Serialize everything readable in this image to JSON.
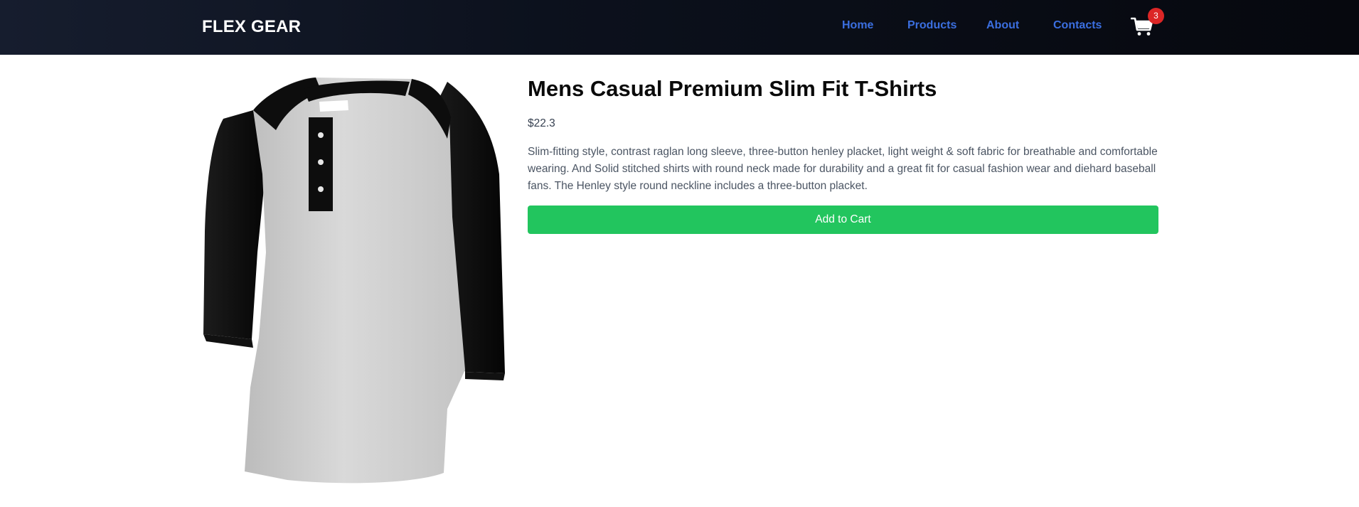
{
  "navbar": {
    "brand": "FLEX GEAR",
    "links": [
      {
        "label": "Home"
      },
      {
        "label": "Products"
      },
      {
        "label": "About"
      },
      {
        "label": "Contacts"
      }
    ],
    "cart": {
      "icon": "cart-icon",
      "count": "3"
    }
  },
  "product": {
    "title": "Mens Casual Premium Slim Fit T-Shirts",
    "price": "$22.3",
    "description": "Slim-fitting style, contrast raglan long sleeve, three-button henley placket, light weight & soft fabric for breathable and comfortable wearing. And Solid stitched shirts with round neck made for durability and a great fit for casual fashion wear and diehard baseball fans. The Henley style round neckline includes a three-button placket.",
    "add_to_cart_label": "Add to Cart"
  },
  "colors": {
    "nav_link": "#3b6fe0",
    "add_button": "#22c55e",
    "badge": "#dc2626"
  }
}
